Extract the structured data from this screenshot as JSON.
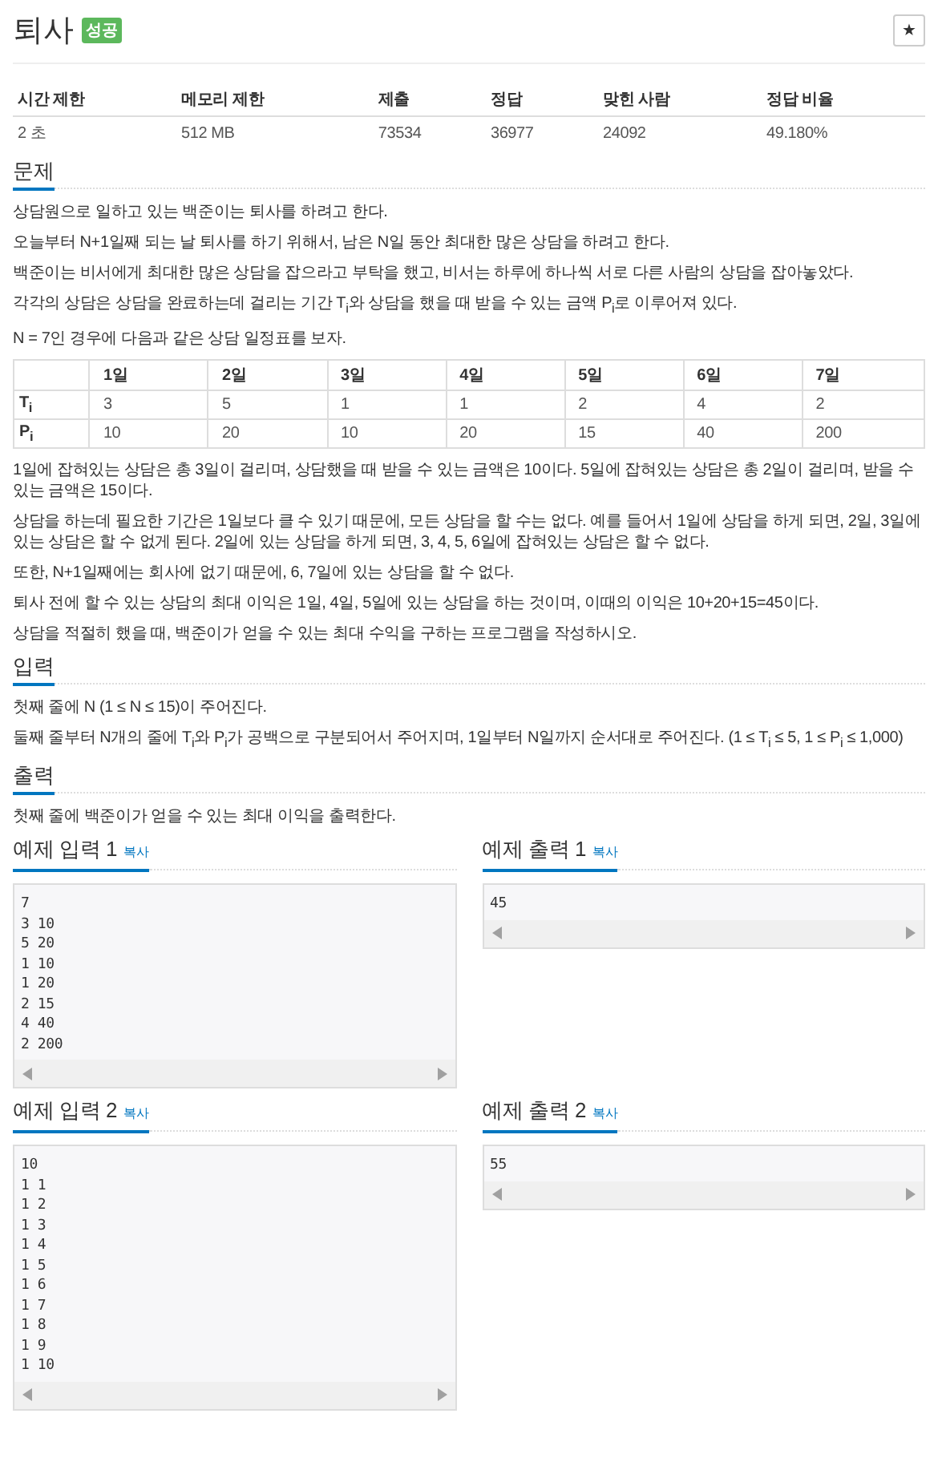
{
  "problem": {
    "title": "퇴사",
    "badge": "성공",
    "star_button": "★"
  },
  "stats": {
    "columns": [
      "시간 제한",
      "메모리 제한",
      "제출",
      "정답",
      "맞힌 사람",
      "정답 비율"
    ],
    "values": [
      "2 초",
      "512 MB",
      "73534",
      "36977",
      "24092",
      "49.180%"
    ]
  },
  "sections": [
    {
      "heading": "문제",
      "blocks": [
        {
          "kind": "paragraph",
          "text": "상담원으로 일하고 있는 백준이는 퇴사를 하려고 한다."
        },
        {
          "kind": "paragraph",
          "text": "오늘부터 N+1일째 되는 날 퇴사를 하기 위해서, 남은 N일 동안 최대한 많은 상담을 하려고 한다."
        },
        {
          "kind": "paragraph",
          "text": "백준이는 비서에게 최대한 많은 상담을 잡으라고 부탁을 했고, 비서는 하루에 하나씩 서로 다른 사람의 상담을 잡아놓았다."
        },
        {
          "kind": "paragraph",
          "text": "각각의 상담은 상담을 완료하는데 걸리는 기간 T$_{i}$와 상담을 했을 때 받을 수 있는 금액 P$_{i}$로 이루어져 있다."
        },
        {
          "kind": "paragraph",
          "text": "N = 7인 경우에 다음과 같은 상담 일정표를 보자."
        },
        {
          "kind": "table",
          "columns": [
            "1일",
            "2일",
            "3일",
            "4일",
            "5일",
            "6일",
            "7일"
          ],
          "rows": [
            {
              "label": "T$_{i}$",
              "cells": [
                "3",
                "5",
                "1",
                "1",
                "2",
                "4",
                "2"
              ]
            },
            {
              "label": "P$_{i}$",
              "cells": [
                "10",
                "20",
                "10",
                "20",
                "15",
                "40",
                "200"
              ]
            }
          ]
        },
        {
          "kind": "paragraph",
          "text": "1일에 잡혀있는 상담은 총 3일이 걸리며, 상담했을 때 받을 수 있는 금액은 10이다. 5일에 잡혀있는 상담은 총 2일이 걸리며, 받을 수 있는 금액은 15이다."
        },
        {
          "kind": "paragraph",
          "text": "상담을 하는데 필요한 기간은 1일보다 클 수 있기 때문에, 모든 상담을 할 수는 없다. 예를 들어서 1일에 상담을 하게 되면, 2일, 3일에 있는 상담은 할 수 없게 된다. 2일에 있는 상담을 하게 되면, 3, 4, 5, 6일에 잡혀있는 상담은 할 수 없다."
        },
        {
          "kind": "paragraph",
          "text": "또한, N+1일째에는 회사에 없기 때문에, 6, 7일에 있는 상담을 할 수 없다."
        },
        {
          "kind": "paragraph",
          "text": "퇴사 전에 할 수 있는 상담의 최대 이익은 1일, 4일, 5일에 있는 상담을 하는 것이며, 이때의 이익은 10+20+15=45이다."
        },
        {
          "kind": "paragraph",
          "text": "상담을 적절히 했을 때, 백준이가 얻을 수 있는 최대 수익을 구하는 프로그램을 작성하시오."
        }
      ]
    },
    {
      "heading": "입력",
      "blocks": [
        {
          "kind": "paragraph",
          "text": "첫째 줄에 N (1 ≤ N ≤ 15)이 주어진다."
        },
        {
          "kind": "paragraph",
          "text": "둘째 줄부터 N개의 줄에 T$_{i}$와 P$_{i}$가 공백으로 구분되어서 주어지며, 1일부터 N일까지 순서대로 주어진다. (1 ≤ T$_{i}$ ≤ 5, 1 ≤ P$_{i}$ ≤ 1,000)"
        }
      ]
    },
    {
      "heading": "출력",
      "blocks": [
        {
          "kind": "paragraph",
          "text": "첫째 줄에 백준이가 얻을 수 있는 최대 이익을 출력한다."
        }
      ]
    }
  ],
  "samples": [
    {
      "title": "예제 입력 1",
      "copy": "복사",
      "content": "7\n3 10\n5 20\n1 10\n1 20\n2 15\n4 40\n2 200"
    },
    {
      "title": "예제 출력 1",
      "copy": "복사",
      "content": "45"
    },
    {
      "title": "예제 입력 2",
      "copy": "복사",
      "content": "10\n1 1\n1 2\n1 3\n1 4\n1 5\n1 6\n1 7\n1 8\n1 9\n1 10"
    },
    {
      "title": "예제 출력 2",
      "copy": "복사",
      "content": "55"
    }
  ]
}
